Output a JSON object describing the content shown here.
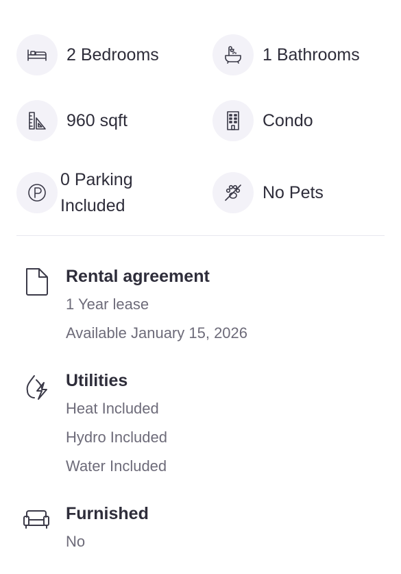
{
  "features": [
    {
      "label": "2 Bedrooms",
      "icon": "bed-icon"
    },
    {
      "label": "1 Bathrooms",
      "icon": "bathtub-icon"
    },
    {
      "label": "960 sqft",
      "icon": "ruler-triangle-icon"
    },
    {
      "label": "Condo",
      "icon": "building-icon"
    },
    {
      "label": "0 Parking Included",
      "icon": "parking-icon"
    },
    {
      "label": "No Pets",
      "icon": "no-pets-icon"
    }
  ],
  "rental": {
    "title": "Rental agreement",
    "lines": [
      "1 Year lease",
      "Available January 15, 2026"
    ]
  },
  "utilities": {
    "title": "Utilities",
    "lines": [
      "Heat Included",
      "Hydro Included",
      "Water Included"
    ]
  },
  "furnished": {
    "title": "Furnished",
    "lines": [
      "No"
    ]
  },
  "colors": {
    "text": "#2e2d3a",
    "muted": "#6d6b79",
    "icon_bg": "#f3f2f8",
    "divider": "#e8e7ee"
  }
}
